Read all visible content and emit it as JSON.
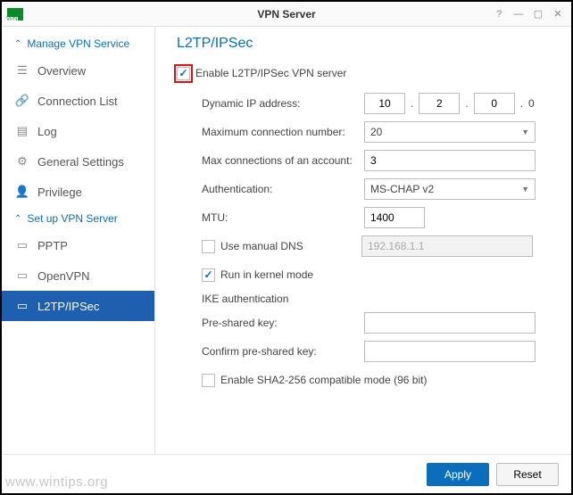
{
  "window": {
    "title": "VPN Server"
  },
  "sidebar": {
    "section1": "Manage VPN Service",
    "items1": [
      {
        "label": "Overview"
      },
      {
        "label": "Connection List"
      },
      {
        "label": "Log"
      },
      {
        "label": "General Settings"
      },
      {
        "label": "Privilege"
      }
    ],
    "section2": "Set up VPN Server",
    "items2": [
      {
        "label": "PPTP"
      },
      {
        "label": "OpenVPN"
      },
      {
        "label": "L2TP/IPSec"
      }
    ]
  },
  "page": {
    "title": "L2TP/IPSec",
    "enable_label": "Enable L2TP/IPSec VPN server",
    "dyn_ip_label": "Dynamic IP address:",
    "dyn_ip": {
      "a": "10",
      "b": "2",
      "c": "0",
      "d": "0"
    },
    "max_conn_label": "Maximum connection number:",
    "max_conn_value": "20",
    "max_acct_label": "Max connections of an account:",
    "max_acct_value": "3",
    "auth_label": "Authentication:",
    "auth_value": "MS-CHAP v2",
    "mtu_label": "MTU:",
    "mtu_value": "1400",
    "manual_dns_label": "Use manual DNS",
    "manual_dns_value": "192.168.1.1",
    "kernel_label": "Run in kernel mode",
    "ike_label": "IKE authentication",
    "psk_label": "Pre-shared key:",
    "psk_confirm_label": "Confirm pre-shared key:",
    "sha2_label": "Enable SHA2-256 compatible mode (96 bit)"
  },
  "footer": {
    "apply": "Apply",
    "reset": "Reset"
  },
  "watermark": "www.wintips.org"
}
